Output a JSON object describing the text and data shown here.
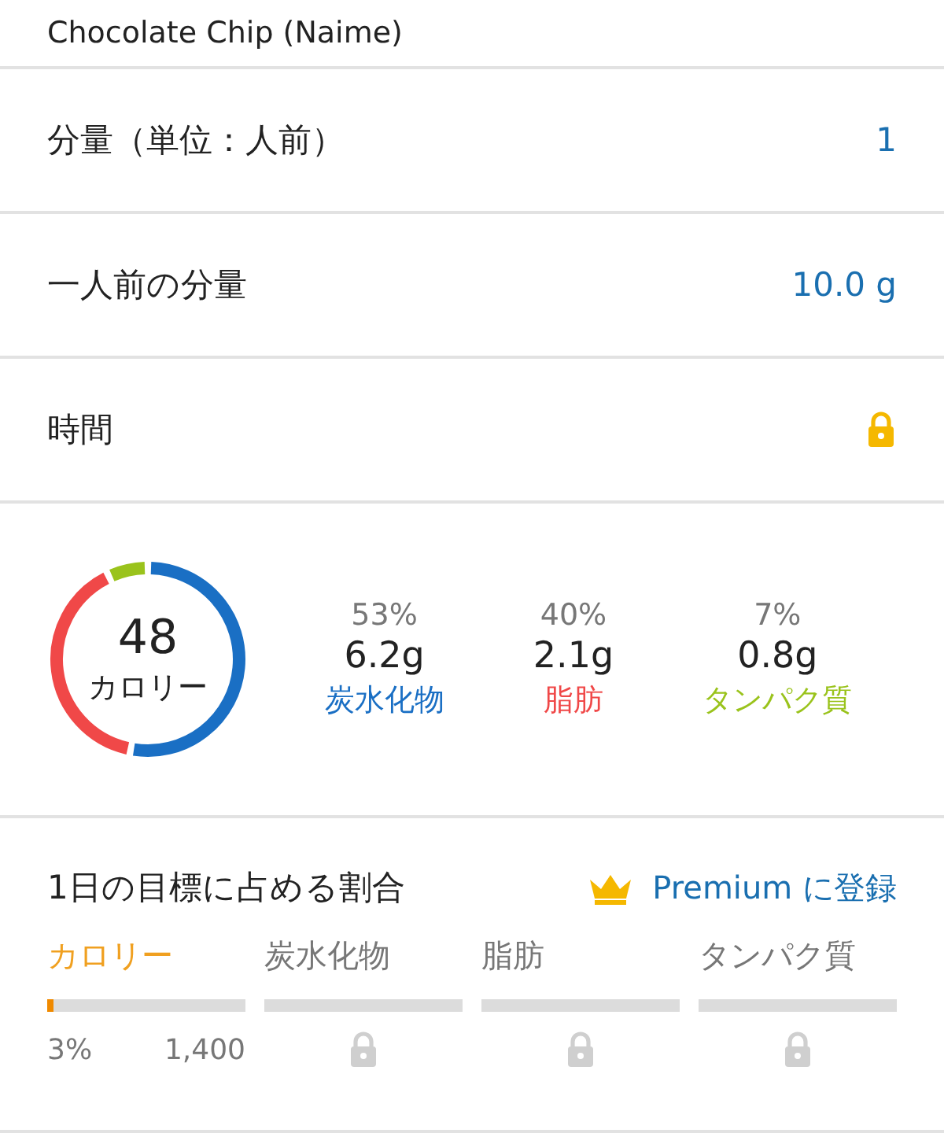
{
  "food_title": "Chocolate Chip (Naime)",
  "rows": [
    {
      "label": "分量（単位：人前）",
      "kind": "value",
      "value": "1"
    },
    {
      "label": "一人前の分量",
      "kind": "value",
      "value": "10.0 g"
    },
    {
      "label": "時間",
      "kind": "locked"
    }
  ],
  "calories": {
    "value": "48",
    "label": "カロリー"
  },
  "macros": [
    {
      "percent": "53%",
      "amount": "6.2g",
      "name": "炭水化物",
      "color": "#1a6fc4"
    },
    {
      "percent": "40%",
      "amount": "2.1g",
      "name": "脂肪",
      "color": "#f04848"
    },
    {
      "percent": "7%",
      "amount": "0.8g",
      "name": "タンパク質",
      "color": "#9ac31c"
    }
  ],
  "goals": {
    "title": "1日の目標に占める割合",
    "premium_link": "Premium に登録",
    "items": [
      {
        "label": "カロリー",
        "kind": "unlocked",
        "level": 0.03,
        "percent": "3%",
        "goal": "1,400"
      },
      {
        "label": "炭水化物",
        "kind": "locked"
      },
      {
        "label": "脂肪",
        "kind": "locked"
      },
      {
        "label": "タンパク質",
        "kind": "locked"
      }
    ]
  }
}
